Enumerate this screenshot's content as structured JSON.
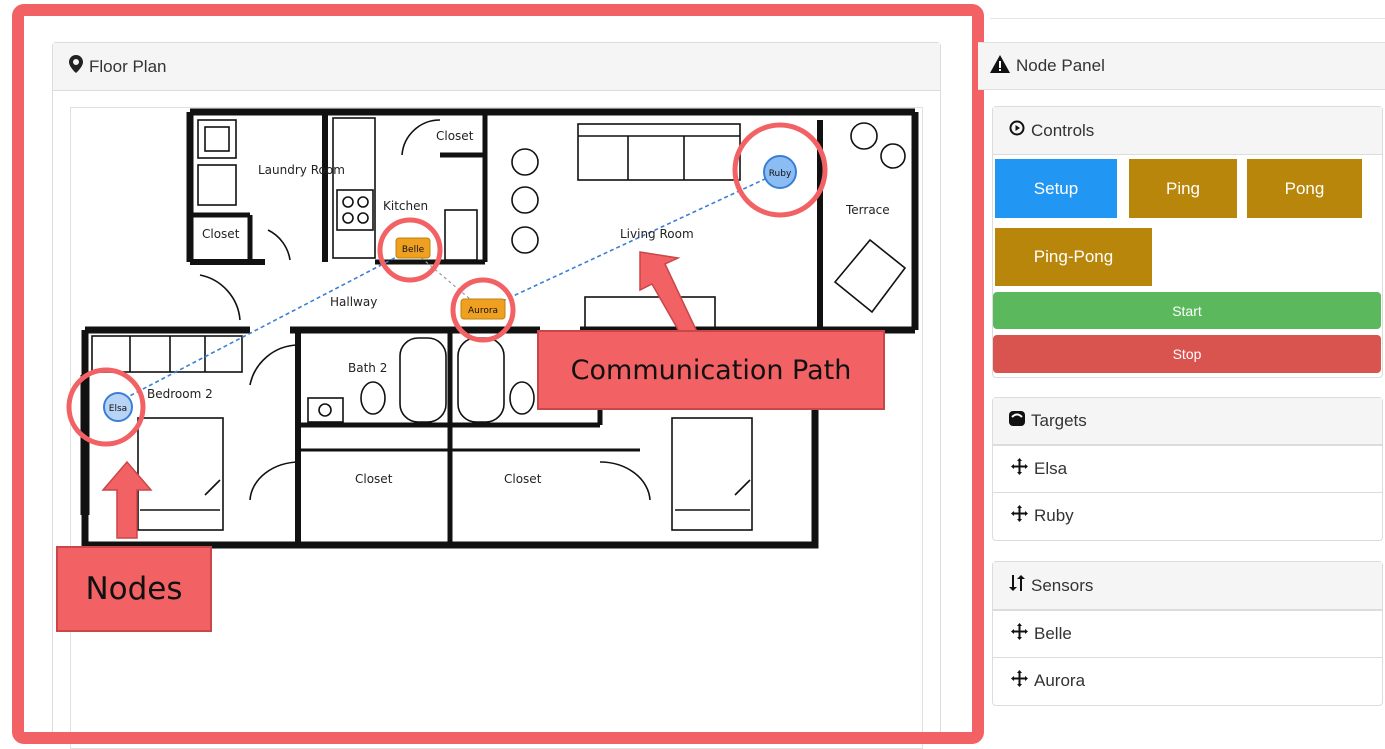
{
  "floor_plan": {
    "title": "Floor Plan",
    "rooms": {
      "closet_kitchen": "Closet",
      "laundry": "Laundry Room",
      "kitchen": "Kitchen",
      "closet_left": "Closet",
      "living_room": "Living Room",
      "terrace": "Terrace",
      "hallway": "Hallway",
      "bath2": "Bath 2",
      "bedroom2": "Bedroom 2",
      "closet_bottom_left": "Closet",
      "closet_bottom_right": "Closet"
    },
    "nodes": {
      "elsa": "Elsa",
      "belle": "Belle",
      "aurora": "Aurora",
      "ruby": "Ruby"
    }
  },
  "annotations": {
    "communication_path": "Communication Path",
    "nodes": "Nodes"
  },
  "node_panel": {
    "title": "Node Panel",
    "controls": {
      "title": "Controls",
      "setup": "Setup",
      "ping": "Ping",
      "pong": "Pong",
      "ping_pong": "Ping-Pong",
      "start": "Start",
      "stop": "Stop"
    },
    "targets": {
      "title": "Targets",
      "items": [
        "Elsa",
        "Ruby"
      ]
    },
    "sensors": {
      "title": "Sensors",
      "items": [
        "Belle",
        "Aurora"
      ]
    }
  },
  "colors": {
    "highlight": "#f26163",
    "setup": "#2196f3",
    "ping": "#b8860b",
    "start": "#5cb85c",
    "stop": "#d9534f",
    "target_node": "#8bbcf3",
    "sensor_node": "#f0a020"
  }
}
